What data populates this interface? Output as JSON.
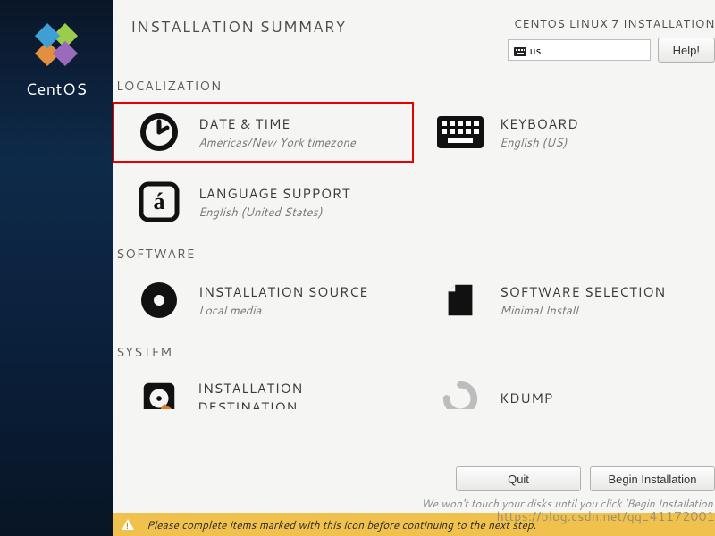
{
  "header": {
    "title": "INSTALLATION SUMMARY",
    "subtitle": "CENTOS LINUX 7 INSTALLATION",
    "keyboard_layout": "us",
    "help_label": "Help!"
  },
  "sidebar": {
    "brand": "CentOS"
  },
  "sections": {
    "localization": {
      "heading": "LOCALIZATION",
      "date_time": {
        "title": "DATE & TIME",
        "status": "Americas/New York timezone"
      },
      "keyboard": {
        "title": "KEYBOARD",
        "status": "English (US)"
      },
      "language": {
        "title": "LANGUAGE SUPPORT",
        "status": "English (United States)"
      }
    },
    "software": {
      "heading": "SOFTWARE",
      "source": {
        "title": "INSTALLATION SOURCE",
        "status": "Local media"
      },
      "selection": {
        "title": "SOFTWARE SELECTION",
        "status": "Minimal Install"
      }
    },
    "system": {
      "heading": "SYSTEM",
      "destination": {
        "title": "INSTALLATION DESTINATION",
        "status": ""
      },
      "kdump": {
        "title": "KDUMP",
        "status": ""
      }
    }
  },
  "footer": {
    "quit_label": "Quit",
    "begin_label": "Begin Installation",
    "hint": "We won't touch your disks until you click 'Begin Installation'"
  },
  "warning_bar": "Please complete items marked with this icon before continuing to the next step.",
  "watermark": "https://blog.csdn.net/qq_41172001"
}
